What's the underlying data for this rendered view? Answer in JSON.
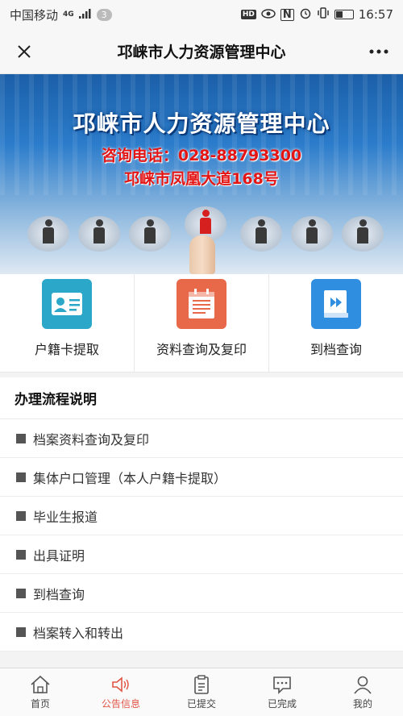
{
  "statusbar": {
    "carrier": "中国移动",
    "network": "4G",
    "badge": "3",
    "hd": "HD",
    "nfc": "N",
    "time": "16:57",
    "battery_level": 0.45
  },
  "header": {
    "close_icon": "close-icon",
    "title": "邛崃市人力资源管理中心",
    "more_icon": "more-icon"
  },
  "banner": {
    "title": "邛崃市人力资源管理中心",
    "phone": "咨询电话：028-88793300",
    "address": "邛崃市凤凰大道168号"
  },
  "quick_actions": [
    {
      "label": "户籍卡提取",
      "icon": "id-card-icon",
      "color": "#2aa7c9"
    },
    {
      "label": "资料查询及复印",
      "icon": "document-icon",
      "color": "#e8684a"
    },
    {
      "label": "到档查询",
      "icon": "book-icon",
      "color": "#2f8ee0"
    }
  ],
  "flow": {
    "title": "办理流程说明",
    "items": [
      "档案资料查询及复印",
      "集体户口管理（本人户籍卡提取）",
      "毕业生报道",
      "出具证明",
      "到档查询",
      "档案转入和转出"
    ]
  },
  "tabbar": [
    {
      "label": "首页",
      "icon": "home-icon"
    },
    {
      "label": "公告信息",
      "icon": "speaker-icon",
      "color": "#e05545"
    },
    {
      "label": "已提交",
      "icon": "clipboard-icon"
    },
    {
      "label": "已完成",
      "icon": "chat-icon"
    },
    {
      "label": "我的",
      "icon": "user-icon"
    }
  ]
}
